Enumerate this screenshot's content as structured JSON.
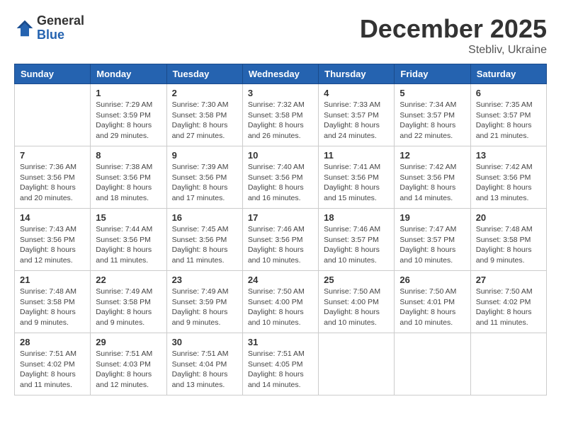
{
  "header": {
    "logo_general": "General",
    "logo_blue": "Blue",
    "month_title": "December 2025",
    "location": "Stebliv, Ukraine"
  },
  "days_of_week": [
    "Sunday",
    "Monday",
    "Tuesday",
    "Wednesday",
    "Thursday",
    "Friday",
    "Saturday"
  ],
  "weeks": [
    [
      {
        "day": "",
        "sunrise": "",
        "sunset": "",
        "daylight": ""
      },
      {
        "day": "1",
        "sunrise": "Sunrise: 7:29 AM",
        "sunset": "Sunset: 3:59 PM",
        "daylight": "Daylight: 8 hours and 29 minutes."
      },
      {
        "day": "2",
        "sunrise": "Sunrise: 7:30 AM",
        "sunset": "Sunset: 3:58 PM",
        "daylight": "Daylight: 8 hours and 27 minutes."
      },
      {
        "day": "3",
        "sunrise": "Sunrise: 7:32 AM",
        "sunset": "Sunset: 3:58 PM",
        "daylight": "Daylight: 8 hours and 26 minutes."
      },
      {
        "day": "4",
        "sunrise": "Sunrise: 7:33 AM",
        "sunset": "Sunset: 3:57 PM",
        "daylight": "Daylight: 8 hours and 24 minutes."
      },
      {
        "day": "5",
        "sunrise": "Sunrise: 7:34 AM",
        "sunset": "Sunset: 3:57 PM",
        "daylight": "Daylight: 8 hours and 22 minutes."
      },
      {
        "day": "6",
        "sunrise": "Sunrise: 7:35 AM",
        "sunset": "Sunset: 3:57 PM",
        "daylight": "Daylight: 8 hours and 21 minutes."
      }
    ],
    [
      {
        "day": "7",
        "sunrise": "Sunrise: 7:36 AM",
        "sunset": "Sunset: 3:56 PM",
        "daylight": "Daylight: 8 hours and 20 minutes."
      },
      {
        "day": "8",
        "sunrise": "Sunrise: 7:38 AM",
        "sunset": "Sunset: 3:56 PM",
        "daylight": "Daylight: 8 hours and 18 minutes."
      },
      {
        "day": "9",
        "sunrise": "Sunrise: 7:39 AM",
        "sunset": "Sunset: 3:56 PM",
        "daylight": "Daylight: 8 hours and 17 minutes."
      },
      {
        "day": "10",
        "sunrise": "Sunrise: 7:40 AM",
        "sunset": "Sunset: 3:56 PM",
        "daylight": "Daylight: 8 hours and 16 minutes."
      },
      {
        "day": "11",
        "sunrise": "Sunrise: 7:41 AM",
        "sunset": "Sunset: 3:56 PM",
        "daylight": "Daylight: 8 hours and 15 minutes."
      },
      {
        "day": "12",
        "sunrise": "Sunrise: 7:42 AM",
        "sunset": "Sunset: 3:56 PM",
        "daylight": "Daylight: 8 hours and 14 minutes."
      },
      {
        "day": "13",
        "sunrise": "Sunrise: 7:42 AM",
        "sunset": "Sunset: 3:56 PM",
        "daylight": "Daylight: 8 hours and 13 minutes."
      }
    ],
    [
      {
        "day": "14",
        "sunrise": "Sunrise: 7:43 AM",
        "sunset": "Sunset: 3:56 PM",
        "daylight": "Daylight: 8 hours and 12 minutes."
      },
      {
        "day": "15",
        "sunrise": "Sunrise: 7:44 AM",
        "sunset": "Sunset: 3:56 PM",
        "daylight": "Daylight: 8 hours and 11 minutes."
      },
      {
        "day": "16",
        "sunrise": "Sunrise: 7:45 AM",
        "sunset": "Sunset: 3:56 PM",
        "daylight": "Daylight: 8 hours and 11 minutes."
      },
      {
        "day": "17",
        "sunrise": "Sunrise: 7:46 AM",
        "sunset": "Sunset: 3:56 PM",
        "daylight": "Daylight: 8 hours and 10 minutes."
      },
      {
        "day": "18",
        "sunrise": "Sunrise: 7:46 AM",
        "sunset": "Sunset: 3:57 PM",
        "daylight": "Daylight: 8 hours and 10 minutes."
      },
      {
        "day": "19",
        "sunrise": "Sunrise: 7:47 AM",
        "sunset": "Sunset: 3:57 PM",
        "daylight": "Daylight: 8 hours and 10 minutes."
      },
      {
        "day": "20",
        "sunrise": "Sunrise: 7:48 AM",
        "sunset": "Sunset: 3:58 PM",
        "daylight": "Daylight: 8 hours and 9 minutes."
      }
    ],
    [
      {
        "day": "21",
        "sunrise": "Sunrise: 7:48 AM",
        "sunset": "Sunset: 3:58 PM",
        "daylight": "Daylight: 8 hours and 9 minutes."
      },
      {
        "day": "22",
        "sunrise": "Sunrise: 7:49 AM",
        "sunset": "Sunset: 3:58 PM",
        "daylight": "Daylight: 8 hours and 9 minutes."
      },
      {
        "day": "23",
        "sunrise": "Sunrise: 7:49 AM",
        "sunset": "Sunset: 3:59 PM",
        "daylight": "Daylight: 8 hours and 9 minutes."
      },
      {
        "day": "24",
        "sunrise": "Sunrise: 7:50 AM",
        "sunset": "Sunset: 4:00 PM",
        "daylight": "Daylight: 8 hours and 10 minutes."
      },
      {
        "day": "25",
        "sunrise": "Sunrise: 7:50 AM",
        "sunset": "Sunset: 4:00 PM",
        "daylight": "Daylight: 8 hours and 10 minutes."
      },
      {
        "day": "26",
        "sunrise": "Sunrise: 7:50 AM",
        "sunset": "Sunset: 4:01 PM",
        "daylight": "Daylight: 8 hours and 10 minutes."
      },
      {
        "day": "27",
        "sunrise": "Sunrise: 7:50 AM",
        "sunset": "Sunset: 4:02 PM",
        "daylight": "Daylight: 8 hours and 11 minutes."
      }
    ],
    [
      {
        "day": "28",
        "sunrise": "Sunrise: 7:51 AM",
        "sunset": "Sunset: 4:02 PM",
        "daylight": "Daylight: 8 hours and 11 minutes."
      },
      {
        "day": "29",
        "sunrise": "Sunrise: 7:51 AM",
        "sunset": "Sunset: 4:03 PM",
        "daylight": "Daylight: 8 hours and 12 minutes."
      },
      {
        "day": "30",
        "sunrise": "Sunrise: 7:51 AM",
        "sunset": "Sunset: 4:04 PM",
        "daylight": "Daylight: 8 hours and 13 minutes."
      },
      {
        "day": "31",
        "sunrise": "Sunrise: 7:51 AM",
        "sunset": "Sunset: 4:05 PM",
        "daylight": "Daylight: 8 hours and 14 minutes."
      },
      {
        "day": "",
        "sunrise": "",
        "sunset": "",
        "daylight": ""
      },
      {
        "day": "",
        "sunrise": "",
        "sunset": "",
        "daylight": ""
      },
      {
        "day": "",
        "sunrise": "",
        "sunset": "",
        "daylight": ""
      }
    ]
  ]
}
